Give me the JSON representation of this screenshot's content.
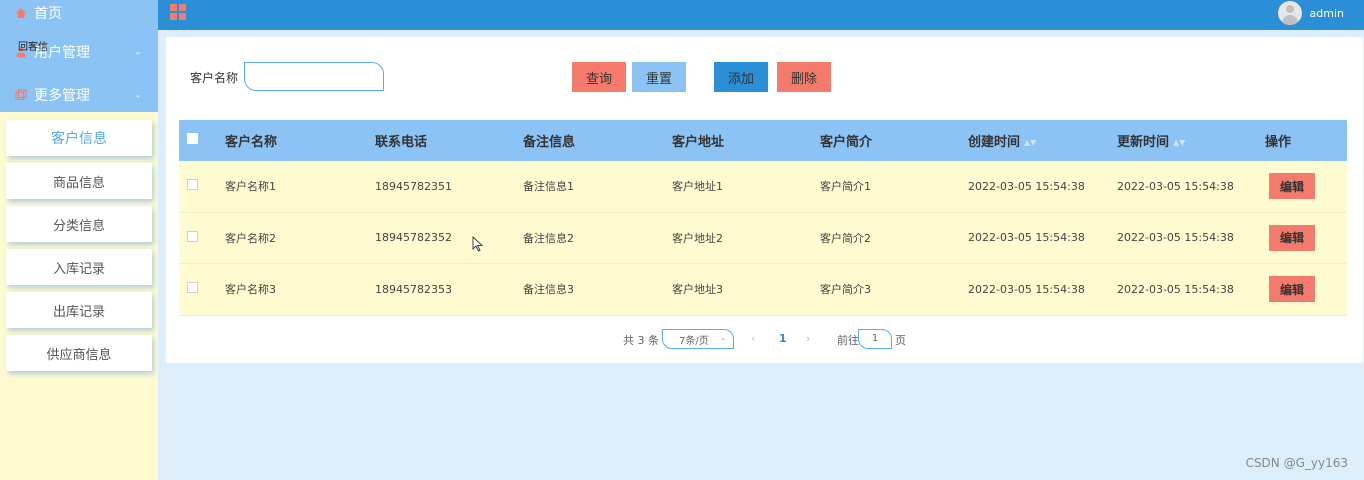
{
  "sidebar": {
    "home_label": "首页",
    "users_label": "用户管理",
    "more_label": "更多管理",
    "overlay_text": "回客信",
    "items": [
      {
        "label": "客户信息",
        "active": true
      },
      {
        "label": "商品信息"
      },
      {
        "label": "分类信息"
      },
      {
        "label": "入库记录"
      },
      {
        "label": "出库记录"
      },
      {
        "label": "供应商信息"
      }
    ]
  },
  "header": {
    "username": "admin"
  },
  "search": {
    "label": "客户名称",
    "value": "",
    "query_label": "查询",
    "reset_label": "重置",
    "add_label": "添加",
    "delete_label": "删除"
  },
  "table": {
    "headers": [
      "客户名称",
      "联系电话",
      "备注信息",
      "客户地址",
      "客户简介",
      "创建时间",
      "更新时间",
      "操作"
    ],
    "rows": [
      [
        "客户名称1",
        "18945782351",
        "备注信息1",
        "客户地址1",
        "客户简介1",
        "2022-03-05 15:54:38",
        "2022-03-05 15:54:38"
      ],
      [
        "客户名称2",
        "18945782352",
        "备注信息2",
        "客户地址2",
        "客户简介2",
        "2022-03-05 15:54:38",
        "2022-03-05 15:54:38"
      ],
      [
        "客户名称3",
        "18945782353",
        "备注信息3",
        "客户地址3",
        "客户简介3",
        "2022-03-05 15:54:38",
        "2022-03-05 15:54:38"
      ]
    ],
    "edit_label": "编辑"
  },
  "pager": {
    "total": "共 3 条",
    "page_size": "7条/页",
    "current": "1",
    "goto_label": "前往",
    "jump_value": "1",
    "page_label": "页"
  },
  "watermark": "CSDN @G_yy163",
  "colors": {
    "accent_blue": "#2a8fd6",
    "light_blue": "#8cc3f5",
    "coral": "#f47b6b",
    "cream": "#fffbd0"
  }
}
